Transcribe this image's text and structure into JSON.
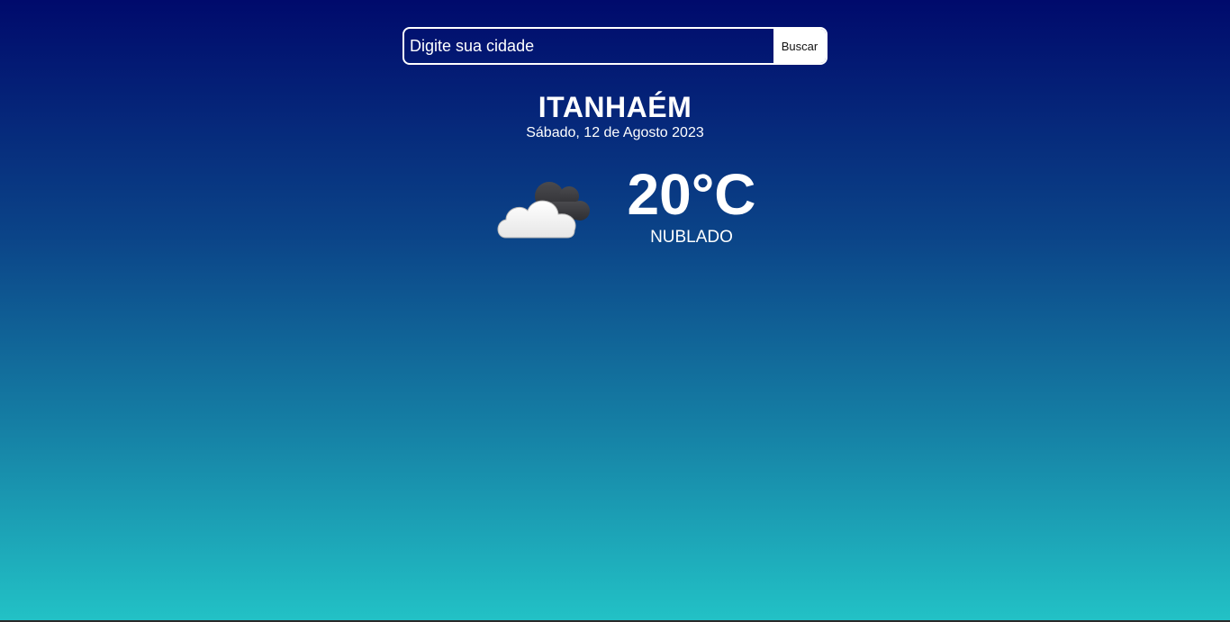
{
  "search": {
    "placeholder": "Digite sua cidade",
    "value": "",
    "button_label": "Buscar"
  },
  "weather": {
    "city": "ITANHAÉM",
    "date": "Sábado, 12 de Agosto 2023",
    "temperature": "20°C",
    "condition": "NUBLADO",
    "icon": "cloudy-icon"
  },
  "colors": {
    "background_top": "#000a6c",
    "background_bottom": "#22c2c6",
    "text": "#ffffff",
    "button_bg": "#ffffff"
  }
}
